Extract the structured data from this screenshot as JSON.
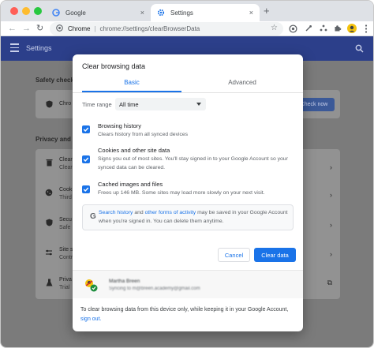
{
  "browser": {
    "traffic_lights": [
      "#ff5f57",
      "#febc2e",
      "#28c840"
    ],
    "tabs": [
      {
        "label": "Google",
        "active": false
      },
      {
        "label": "Settings",
        "active": true
      }
    ],
    "tab_close": "×",
    "new_tab": "+",
    "address": {
      "origin": "Chrome",
      "separator": "|",
      "path": "chrome://settings/clearBrowserData"
    }
  },
  "settings": {
    "header_title": "Settings",
    "accent": "#1a73e8",
    "safety_check_label": "Safety check",
    "safety_row_text": "Chro",
    "check_now_label": "Check now",
    "privacy_label": "Privacy and s",
    "rows": [
      {
        "icon": "trash-icon",
        "title": "Clear",
        "sub": "Clear"
      },
      {
        "icon": "cookie-icon",
        "title": "Cook",
        "sub": "Third"
      },
      {
        "icon": "shield-icon",
        "title": "Secu",
        "sub": "Safe"
      },
      {
        "icon": "sliders-icon",
        "title": "Site s",
        "sub": "Contr"
      },
      {
        "icon": "flask-icon",
        "title": "Priva",
        "sub": "Trial"
      }
    ]
  },
  "dialog": {
    "title": "Clear browsing data",
    "tabs": {
      "basic": "Basic",
      "advanced": "Advanced"
    },
    "time_range_label": "Time range",
    "time_range_value": "All time",
    "options": [
      {
        "title": "Browsing history",
        "desc": "Clears history from all synced devices",
        "checked": true
      },
      {
        "title": "Cookies and other site data",
        "desc": "Signs you out of most sites. You'll stay signed in to your Google Account so your synced data can be cleared.",
        "checked": true
      },
      {
        "title": "Cached images and files",
        "desc": "Frees up 146 MB. Some sites may load more slowly on your next visit.",
        "checked": true
      }
    ],
    "info": {
      "link1": "Search history",
      "mid1": "and",
      "link2": "other forms of activity",
      "rest": "may be saved in your Google Account when you're signed in. You can delete them anytime."
    },
    "cancel_label": "Cancel",
    "clear_label": "Clear data",
    "account": {
      "name": "Martha Breen",
      "email": "Syncing to m@breen.academy@gmail.com"
    },
    "footer_text": "To clear browsing data from this device only, while keeping it in your Google Account,",
    "footer_link": "sign out."
  }
}
